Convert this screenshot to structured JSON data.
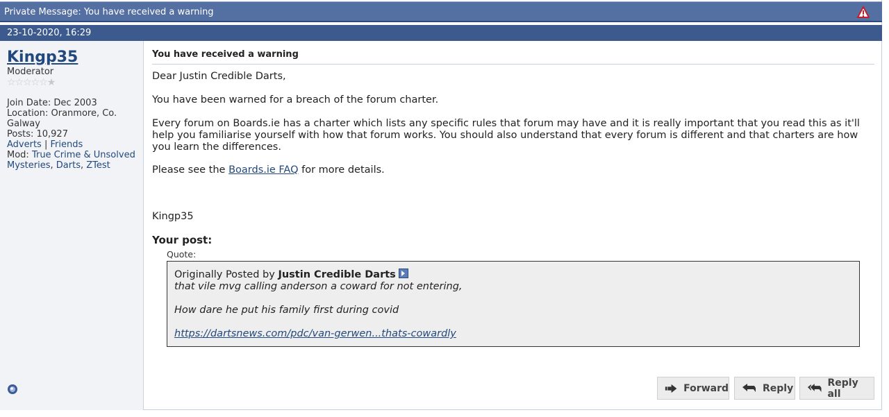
{
  "window": {
    "title": "Private Message: You have received a warning",
    "date": "23-10-2020, 16:29"
  },
  "sender": {
    "username": "Kingp35",
    "usertitle": "Moderator",
    "rating_stars": "☆☆☆☆☆★",
    "join_date": "Join Date: Dec 2003",
    "location_line1": "Location: Oranmore, Co.",
    "location_line2": "Galway",
    "posts": "Posts: 10,927",
    "link_adverts": "Adverts",
    "sep": " | ",
    "link_friends": "Friends",
    "mod_prefix": "Mod: ",
    "mod_forum1": "True Crime & Unsolved",
    "mod_forum1b": "Mysteries",
    "comma": ", ",
    "mod_forum2": "Darts",
    "mod_forum3": "ZTest"
  },
  "message": {
    "subject": "You have received a warning",
    "greeting": "Dear Justin Credible Darts,",
    "para1": "You have been warned for a breach of the forum charter.",
    "para2": "Every forum on Boards.ie has a charter which lists any specific rules that forum may have and it is really important that you read this as it'll help you familiarise yourself with how that forum works. You should also understand that every forum is different and that charters are how you learn the differences.",
    "para3_prefix": "Please see the ",
    "para3_link": "Boards.ie FAQ",
    "para3_suffix": " for more details.",
    "signature": "Kingp35",
    "your_post": "Your post:",
    "quote_label": "Quote:",
    "quote": {
      "originally_prefix": "Originally Posted by ",
      "author": "Justin Credible Darts",
      "line1": "that vile mvg calling anderson a coward for not entering,",
      "line2": "How dare he put his family first during covid",
      "link": "https://dartsnews.com/pdc/van-gerwen...thats-cowardly"
    }
  },
  "buttons": {
    "forward": "Forward",
    "reply": "Reply",
    "reply_all": "Reply all"
  },
  "icons": {
    "warning": "warning-icon",
    "online": "online-status-icon",
    "forward": "forward-arrow-icon",
    "reply": "reply-arrow-icon",
    "reply_all": "reply-all-arrow-icon",
    "view_post": "view-post-arrow-icon"
  },
  "colors": {
    "titlebar": "#5470a2",
    "datebar": "#3d5a8e",
    "link": "#22497d",
    "sidebar_bg": "#f2f3f6",
    "quote_bg": "#eeeeee"
  }
}
